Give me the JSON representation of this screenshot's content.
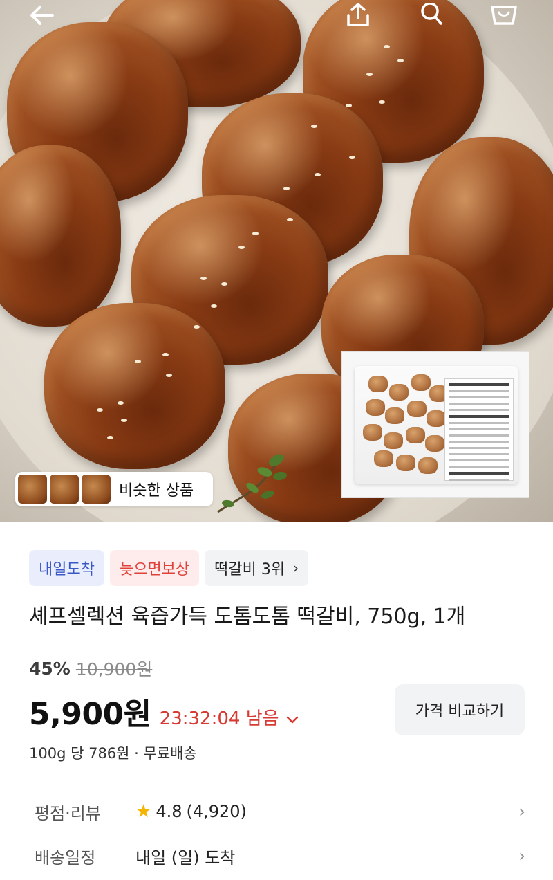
{
  "header": {
    "back_icon": "arrow-left-icon",
    "share_icon": "share-upload-icon",
    "search_icon": "search-icon",
    "cart_icon": "cart-icon"
  },
  "hero": {
    "similar_label": "비슷한 상품"
  },
  "badges": [
    {
      "label": "내일도착"
    },
    {
      "label": "늦으면보상"
    },
    {
      "label": "떡갈비 3위",
      "chevron": "›"
    }
  ],
  "product": {
    "title": "셰프셀렉션 육즙가득 도톰도톰 떡갈비, 750g, 1개",
    "discount": "45%",
    "original_price": "10,900원",
    "price": "5,900원",
    "timer": "23:32:04 남음",
    "compare_label": "가격 비교하기",
    "unit_price": "100g 당 786원 · 무료배송"
  },
  "info": {
    "rating": {
      "key": "평점·리뷰",
      "score": "4.8",
      "count": "(4,920)"
    },
    "delivery": {
      "key": "배송일정",
      "value": "내일 (일) 도착"
    }
  },
  "colors": {
    "accent_red": "#d63a32",
    "badge_blue": "#3a59c7",
    "badge_red": "#e0423a",
    "star": "#f5b400"
  }
}
